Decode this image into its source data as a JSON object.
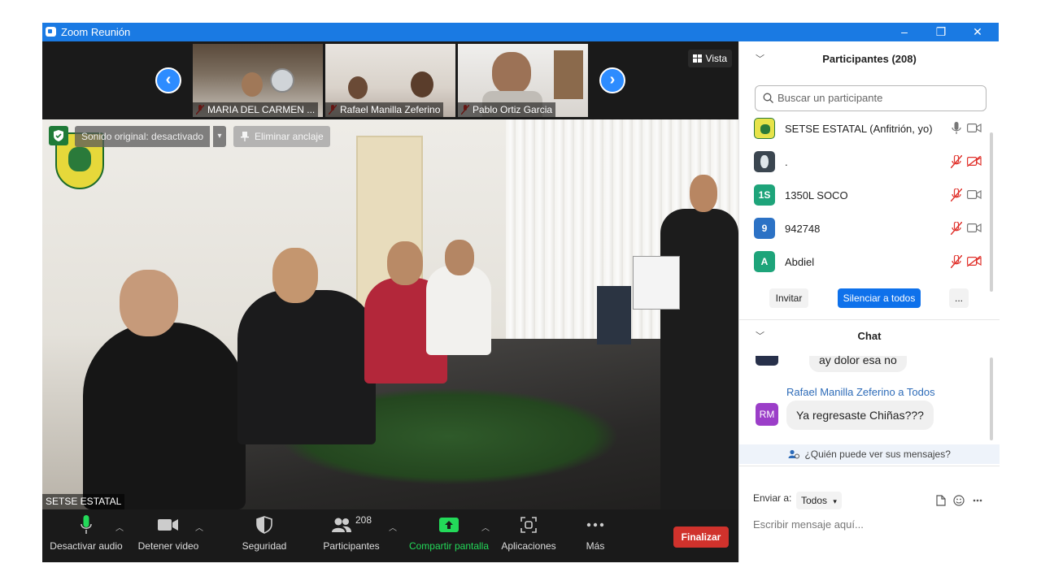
{
  "window": {
    "title": "Zoom Reunión",
    "controls": [
      "–",
      "❐",
      "✕"
    ]
  },
  "strip": {
    "thumbnails": [
      {
        "name": "MARIA DEL CARMEN ..."
      },
      {
        "name": "Rafael Manilla Zeferino"
      },
      {
        "name": "Pablo Ortiz Garcia"
      }
    ],
    "prev": "‹",
    "next": "›",
    "view_label": "Vista"
  },
  "stage": {
    "original_sound": "Sonido original: desactivado",
    "unpin": "Eliminar anclaje",
    "speaker_name": "SETSE ESTATAL"
  },
  "controls": {
    "audio": "Desactivar audio",
    "video": "Detener video",
    "security": "Seguridad",
    "participants": "Participantes",
    "participants_count": "208",
    "share": "Compartir pantalla",
    "apps": "Aplicaciones",
    "more": "Más",
    "end": "Finalizar"
  },
  "participants_panel": {
    "title": "Participantes (208)",
    "search_placeholder": "Buscar un participante",
    "list": [
      {
        "initials": "",
        "name": "SETSE ESTATAL (Anfitrión, yo)",
        "color": "#e7e34a"
      },
      {
        "initials": "",
        "name": ".",
        "color": "#3b4650"
      },
      {
        "initials": "1S",
        "name": "1350L SOCO",
        "color": "#1ea47a"
      },
      {
        "initials": "9",
        "name": "942748",
        "color": "#2c72c5"
      },
      {
        "initials": "A",
        "name": "Abdiel",
        "color": "#1ea47a"
      }
    ],
    "invite": "Invitar",
    "mute_all": "Silenciar a todos",
    "more": "..."
  },
  "chat_panel": {
    "title": "Chat",
    "partial_message": "ay dolor esa no",
    "sender": "Rafael Manilla Zeferino a Todos",
    "sender_initials": "RM",
    "message": "Ya regresaste Chiñas???",
    "who_sees": "¿Quién puede ver sus mensajes?",
    "send_to_label": "Enviar a:",
    "send_to_value": "Todos",
    "input_placeholder": "Escribir mensaje aquí..."
  },
  "colors": {
    "accent": "#1a7ae3",
    "end": "#d0322c",
    "share": "#23d959",
    "muted": "#e0322c"
  }
}
